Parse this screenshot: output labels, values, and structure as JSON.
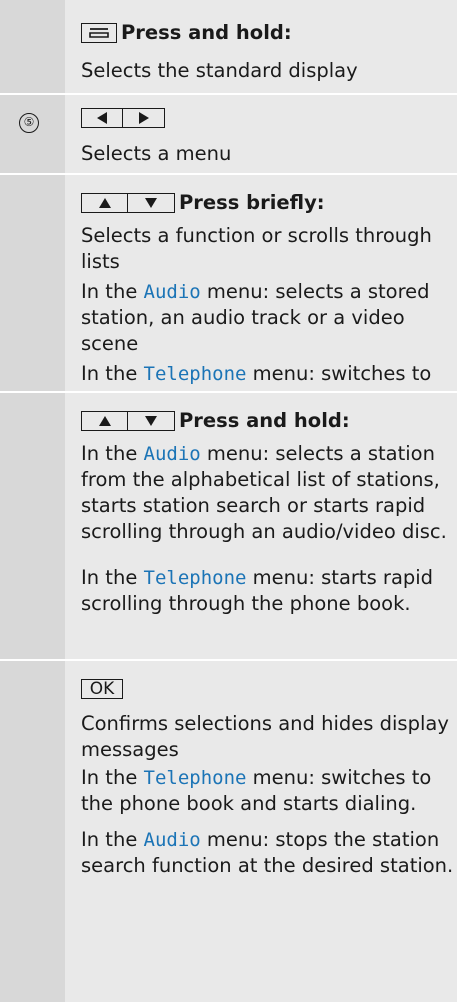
{
  "rows": [
    {
      "number": "",
      "key_label": "Press and hold:",
      "lines": [
        "Selects the standard display"
      ]
    },
    {
      "number": "⑤",
      "lines": [
        "Selects a menu"
      ]
    },
    {
      "key_label": "Press briefly:",
      "p1": "Selects a function or scrolls through lists",
      "p2": {
        "pre": "In the ",
        "hl": "Audio",
        "post": " menu: selects a stored station, an audio track or a video scene"
      },
      "p3": {
        "pre": "In the ",
        "hl": "Telephone",
        "post": " menu: switches to the phone book and selects a name or a telephone number."
      }
    },
    {
      "key_label": "Press and hold:",
      "p1": {
        "pre": "In the ",
        "hl": "Audio",
        "post": " menu: selects a station from the alphabetical list of stations, starts station search or starts rapid scrolling through an audio/video disc."
      },
      "p2": {
        "pre": "In the ",
        "hl": "Telephone",
        "post": " menu: starts rapid scrolling through the phone book."
      }
    },
    {
      "key_text": "OK",
      "p1": "Confirms selections and hides display messages",
      "p2": {
        "pre": "In the ",
        "hl": "Telephone",
        "post": " menu: switches to the phone book and starts dialing."
      },
      "p3": {
        "pre": "In the ",
        "hl": "Audio",
        "post": " menu: stops the station search function at the desired station."
      }
    }
  ],
  "colors": {
    "left_column": "#d8d8d8",
    "content_column": "#e9e9e9",
    "highlight": "#1b74b6"
  },
  "icons": [
    "back-key-icon",
    "left-arrow-key-icon",
    "right-arrow-key-icon",
    "up-arrow-key-icon",
    "down-arrow-key-icon"
  ]
}
